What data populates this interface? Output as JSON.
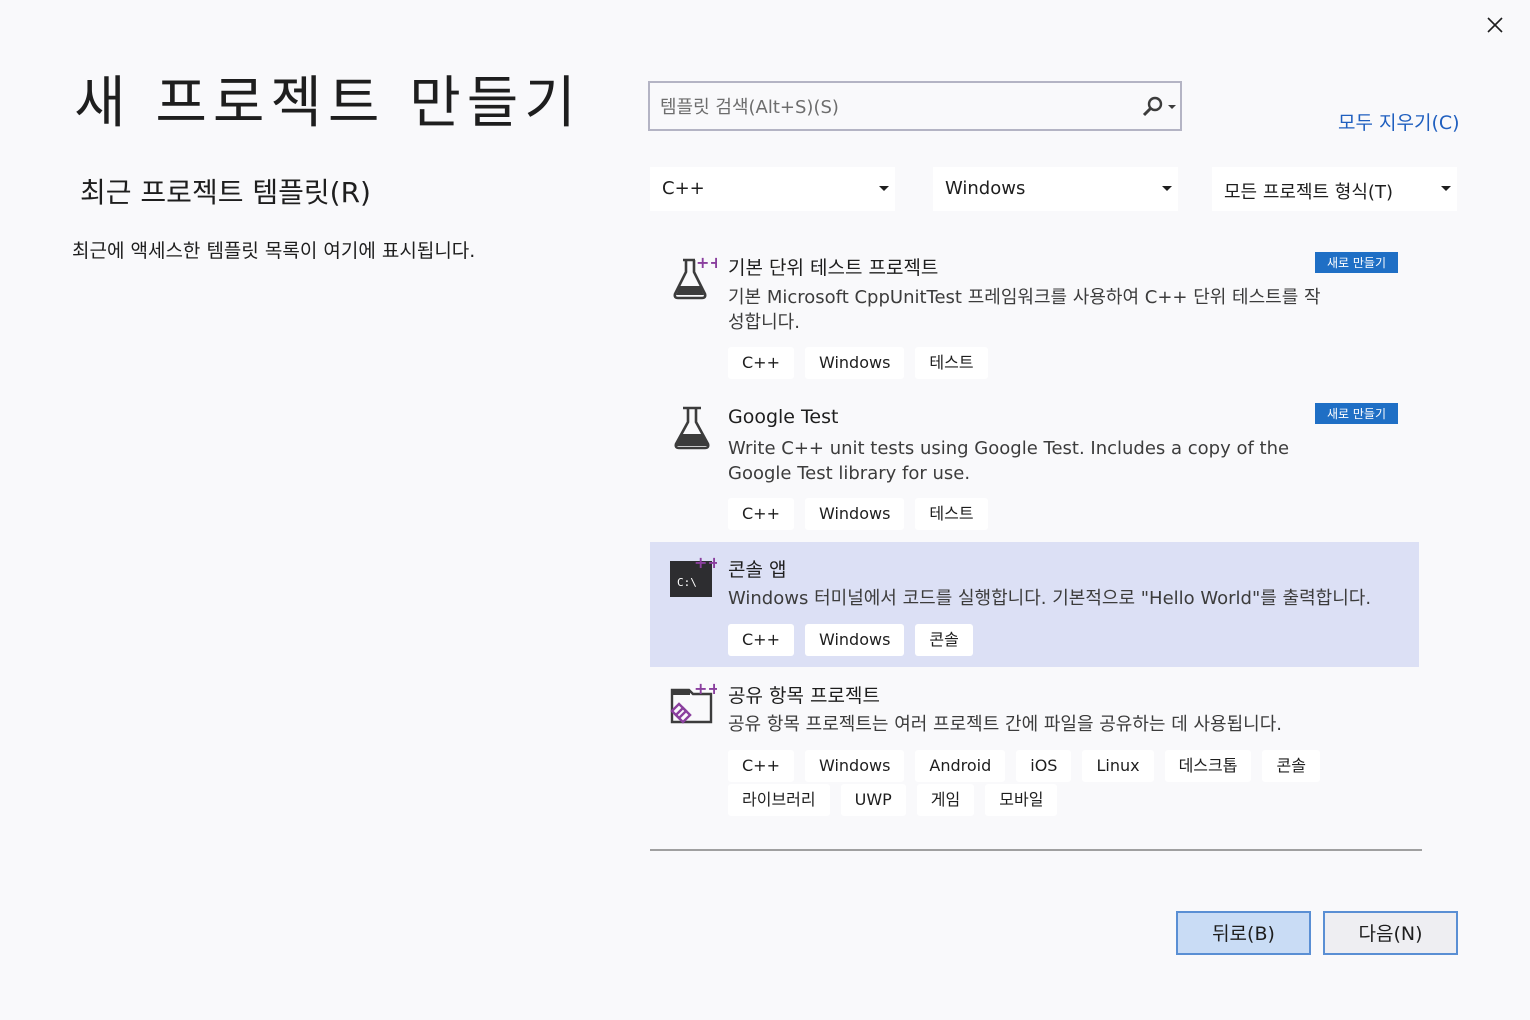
{
  "window": {
    "title": "새 프로젝트 만들기",
    "close_icon": "close-icon"
  },
  "recent": {
    "heading": "최근 프로젝트 템플릿(R)",
    "empty_text": "최근에 액세스한 템플릿 목록이 여기에 표시됩니다."
  },
  "search": {
    "placeholder": "템플릿 검색(Alt+S)(S)",
    "icon": "search-icon"
  },
  "clear_all_label": "모두 지우기(C)",
  "filters": {
    "language": "C++",
    "platform": "Windows",
    "project_type": "모든 프로젝트 형식(T)"
  },
  "templates": [
    {
      "name": "기본 단위 테스트 프로젝트",
      "description": "기본 Microsoft CppUnitTest 프레임워크를 사용하여 C++ 단위 테스트를 작성합니다.",
      "badge": "새로 만들기",
      "icon": "flask-plus-icon",
      "tags": [
        "C++",
        "Windows",
        "테스트"
      ]
    },
    {
      "name": "Google Test",
      "description": "Write C++ unit tests using Google Test. Includes a copy of the Google Test library for use.",
      "badge": "새로 만들기",
      "icon": "flask-icon",
      "tags": [
        "C++",
        "Windows",
        "테스트"
      ]
    },
    {
      "name": "콘솔 앱",
      "description": "Windows 터미널에서 코드를 실행합니다. 기본적으로 \"Hello World\"를 출력합니다.",
      "icon": "console-app-icon",
      "tags": [
        "C++",
        "Windows",
        "콘솔"
      ]
    },
    {
      "name": "공유 항목 프로젝트",
      "description": "공유 항목 프로젝트는 여러 프로젝트 간에 파일을 공유하는 데 사용됩니다.",
      "icon": "shared-items-icon",
      "tags": [
        "C++",
        "Windows",
        "Android",
        "iOS",
        "Linux",
        "데스크톱",
        "콘솔",
        "라이브러리",
        "UWP",
        "게임",
        "모바일"
      ]
    }
  ],
  "buttons": {
    "back": "뒤로(B)",
    "next": "다음(N)"
  },
  "colors": {
    "background": "#f9f9fb",
    "accent_link": "#1f5fbf",
    "badge": "#1f6fc5",
    "selected_row": "#dce0f5",
    "icon_purple": "#8a3f9e"
  }
}
